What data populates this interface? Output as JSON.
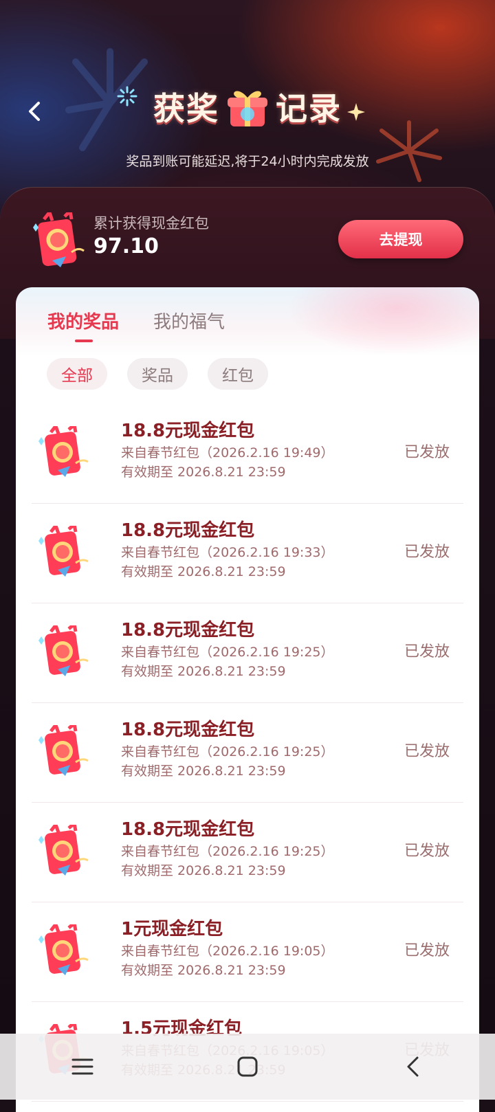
{
  "header": {
    "title_left": "获奖",
    "title_right": "记录",
    "subtitle": "奖品到账可能延迟,将于24小时内完成发放"
  },
  "summary": {
    "label": "累计获得现金红包",
    "amount": "97.10",
    "withdraw_label": "去提现"
  },
  "tabs": [
    {
      "label": "我的奖品",
      "active": true
    },
    {
      "label": "我的福气",
      "active": false
    }
  ],
  "filters": [
    {
      "label": "全部",
      "active": true
    },
    {
      "label": "奖品",
      "active": false
    },
    {
      "label": "红包",
      "active": false
    }
  ],
  "records": [
    {
      "name": "18.8元现金红包",
      "source": "来自春节红包（2026.2.16 19:49）",
      "expire": "有效期至 2026.8.21 23:59",
      "status": "已发放"
    },
    {
      "name": "18.8元现金红包",
      "source": "来自春节红包（2026.2.16 19:33）",
      "expire": "有效期至 2026.8.21 23:59",
      "status": "已发放"
    },
    {
      "name": "18.8元现金红包",
      "source": "来自春节红包（2026.2.16 19:25）",
      "expire": "有效期至 2026.8.21 23:59",
      "status": "已发放"
    },
    {
      "name": "18.8元现金红包",
      "source": "来自春节红包（2026.2.16 19:25）",
      "expire": "有效期至 2026.8.21 23:59",
      "status": "已发放"
    },
    {
      "name": "18.8元现金红包",
      "source": "来自春节红包（2026.2.16 19:25）",
      "expire": "有效期至 2026.8.21 23:59",
      "status": "已发放"
    },
    {
      "name": "1元现金红包",
      "source": "来自春节红包（2026.2.16 19:05）",
      "expire": "有效期至 2026.8.21 23:59",
      "status": "已发放"
    },
    {
      "name": "1.5元现金红包",
      "source": "来自春节红包（2026.2.16 19:05）",
      "expire": "有效期至 2026.8.21 23:59",
      "status": "已发放"
    }
  ],
  "colors": {
    "accent": "#e6394f",
    "item_title": "#8a1f25",
    "item_meta": "#a06a6c"
  },
  "icons": {
    "back": "back-arrow-icon",
    "gift": "gift-box-icon",
    "red_envelope": "red-envelope-icon",
    "nav_menu": "menu-icon",
    "nav_home": "home-icon",
    "nav_back": "nav-back-icon"
  }
}
